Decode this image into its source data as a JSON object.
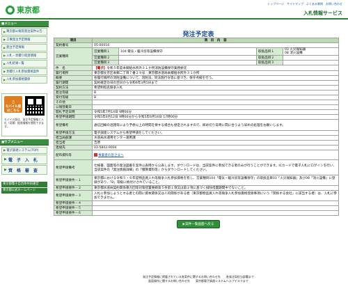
{
  "header": {
    "logo_text": "東京都",
    "links": "トップページ　サイトマップ　よくある質問　お問い合わせ",
    "service_name": "入札情報サービス"
  },
  "sidebar": {
    "menu_title": "■メニュー",
    "items": [
      "東京都公報等発注案件公告",
      "工事発注予定情報",
      "発注予定情報",
      "入札・見積り経過情報",
      "入札結果一覧",
      "見積り入札参加資格案件",
      "入札参加資格関係"
    ],
    "mobile_label": "モバイル版",
    "mobile_sub": "はこちら",
    "mobile_desc": "モバイル版は、発注予定情報と入札（見積）経過情報を閲覧できます。",
    "submenu_title": "■サブメニュー",
    "sub_items": [
      "電子調達システム(TOP)"
    ],
    "big_items": [
      "電　子　入　札",
      "資　格　審　査"
    ],
    "footer_links": [
      "東京都電子自治体共同運営",
      "東京都公式ホームページ"
    ]
  },
  "main": {
    "page_title": "発注予定表",
    "col_item": "項目",
    "col_content": "項　目　内　容",
    "rows": {
      "contract_no_label": "契約番号",
      "contract_no": "05-00016",
      "category_label": "営業種目",
      "category_sub1": "営業種目１",
      "category_val1": "104 電気・暖冷房等設備保守",
      "category_sub2": "営業種目２",
      "category_val2": "",
      "category_sub3": "営業種目３",
      "category_val3": "",
      "trade1_label": "取扱品目１",
      "trade1_val": "03 火災報知器\n08 消火設備",
      "trade2_label": "取扱品目２",
      "trade2_val": "",
      "trade3_label": "取扱品目３",
      "trade3_val": "",
      "subject_label": "件　名",
      "subject_tag": "【電子】",
      "subject_val": "令和５年度本郷給水所外３１か所消防設備保守業務委託",
      "location_label": "履行場所",
      "location_val": "東京都文京区本郷二丁目７番２９号　東京都水道局本郷給水所外３１か所",
      "summary_label": "概要",
      "summary_val": "各履行場所の消防設備について、消防法、同法施行令等に基づき、保守点検を行う。",
      "period_label": "履行期間",
      "period_val": "契約確定の日の翌日から令和6年3月5日まで",
      "method_label": "契約方法",
      "method_val": "希望制指名競争入札",
      "ordertype_label": "発注等級",
      "ordertype_val": "B",
      "acceptgrade_label": "受付等級",
      "acceptgrade_val": "B",
      "other_label": "その他",
      "other_val": "",
      "announce_label": "公報登載日",
      "announce_val": "",
      "open_label": "開札予定日時",
      "open_val": "令和5年7月14日 9時00分",
      "apply_label": "希望申請期間",
      "apply_val": "令和5年6月12日 9時00分から令和5年6月16日 17時00分",
      "hope_label": "希望備考",
      "hope_val": "通信回線の混雑等により予想以上の時間を要する場合も想定されますので、締め切り日時に間に合うよう早めの処理をお願いします。",
      "hope_method_label": "希望申請方法",
      "hope_method_val": "電子調達システムから希望申請をしてください。",
      "dept_label": "担当局部課",
      "dept_val": "水道局水運用センター運用課",
      "person_label": "担当者",
      "person_val": "吉原",
      "contact_label": "連絡先",
      "contact_val": "03-5802-9004",
      "distribute_label": "配布資料等",
      "distribute_link": "事業者の皆さまへ",
      "reqnote_label": "希望申請備考",
      "reqnote_val": "仕様書、図面等の発注図書を案件公表時から公表します。ダウンロードは、当該案件に参加できる者のみが行うことができます。ICカードで電子入札にログインを行い、当該案件の「発注情報詳細」の「積算資料等」からダウンロードしてください。",
      "req1_label": "希望申請要件－１",
      "req1_val": "東京都における令和５・６年度物品買入れ等競争入札参加資格を有し、営業種目104「電気・暖冷房等設備保守」の取扱品目03「火災報知器」及び08「消火設備」に登録があり、「B」等級に格付けされていること。",
      "req2_label": "希望申請要件－２",
      "req2_val": "東京都水道局契約関係暴力団等対策措置要綱第５条第１項又は第２項に基づく排除措置期間中でないこと。",
      "req3_label": "希望申請要件－３",
      "req3_val": "入札に参加しようとする者との間に資本関係又は人的関係がある者（東京都物品買入れ等競争入札参加資格登録事項にいう「関係する会社」に該当する者）は、入札に参加できません。",
      "req4_label": "希望申請要件－４",
      "req4_val": "",
      "req5_label": "希望申請要件－５",
      "req5_val": "",
      "req6_label": "希望申請要件－６",
      "req6_val": ""
    },
    "back_button": "▶案件一覧画面へ戻る"
  },
  "footer": {
    "line1": "発注予定情報に掲載されている各案件に関するお問い合わせ先　　各発注局担当部署まで",
    "line2": "画面操作に関するお問い合わせ先　　東京都電子調達システムヘルプデスクまで"
  }
}
